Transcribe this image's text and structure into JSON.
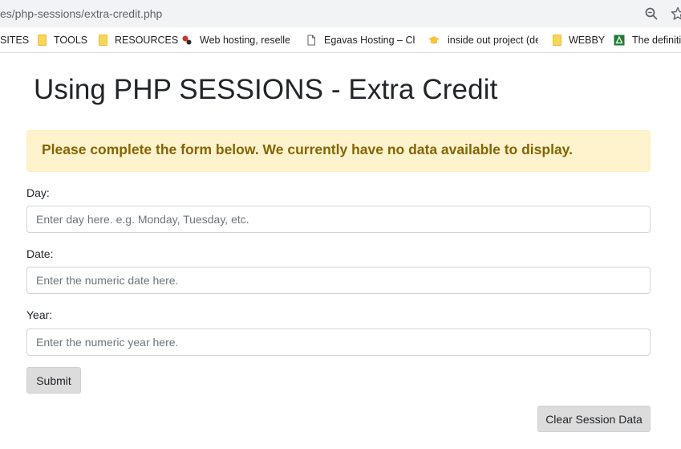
{
  "browser": {
    "url": "es/php-sessions/extra-credit.php",
    "zoom_icon": "zoom-magnifier-icon",
    "star_icon": "bookmark-star-icon"
  },
  "bookmarks": [
    {
      "label": "SITES",
      "icon": "none"
    },
    {
      "label": "TOOLS",
      "icon": "folder-icon"
    },
    {
      "label": "RESOURCES",
      "icon": "folder-icon"
    },
    {
      "label": "Web hosting, reseller",
      "icon": "red-favicon-icon"
    },
    {
      "label": "Egavas Hosting – Che",
      "icon": "page-icon"
    },
    {
      "label": "inside out project (de",
      "icon": "graduation-cap-icon"
    },
    {
      "label": "WEBBY",
      "icon": "folder-icon"
    },
    {
      "label": "The definiti",
      "icon": "green-favicon-icon"
    }
  ],
  "page": {
    "title": "Using PHP SESSIONS - Extra Credit",
    "alert": "Please complete the form below. We currently have no data available to display."
  },
  "form": {
    "day_label": "Day:",
    "day_placeholder": "Enter day here. e.g. Monday, Tuesday, etc.",
    "date_label": "Date:",
    "date_placeholder": "Enter the numeric date here.",
    "year_label": "Year:",
    "year_placeholder": "Enter the numeric year here.",
    "submit_label": "Submit",
    "clear_label": "Clear Session Data"
  },
  "colors": {
    "alert_bg": "#fff3cd",
    "alert_text": "#856404",
    "button_bg": "#dcdcdc"
  }
}
